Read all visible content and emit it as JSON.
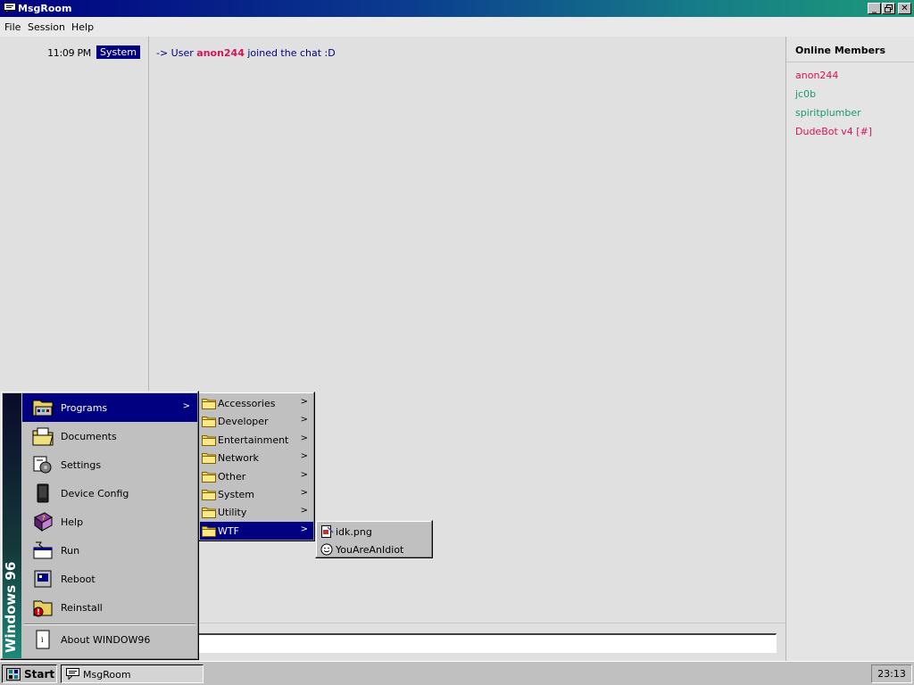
{
  "window": {
    "title": "MsgRoom",
    "controls": {
      "minimize": "_",
      "maximize": "❐",
      "close": "✕"
    }
  },
  "menubar": [
    "File",
    "Session",
    "Help"
  ],
  "chat": {
    "time": "11:09 PM",
    "sender": "System",
    "message_prefix": "-> User",
    "user": "anon244",
    "message_suffix": "joined the chat :D"
  },
  "members": {
    "title": "Online Members",
    "list": [
      {
        "name": "anon244",
        "color": "#d4145a"
      },
      {
        "name": "jc0b",
        "color": "#1b9a6a"
      },
      {
        "name": "spiritplumber",
        "color": "#1b9a6a"
      },
      {
        "name": "DudeBot v4 [#]",
        "color": "#d4145a"
      }
    ]
  },
  "message_input": {
    "value": ""
  },
  "start_menu": {
    "brand": "Windows 96",
    "items": [
      {
        "label": "Programs",
        "icon": "programs-icon",
        "arrow": ">"
      },
      {
        "label": "Documents",
        "icon": "documents-icon"
      },
      {
        "label": "Settings",
        "icon": "settings-icon"
      },
      {
        "label": "Device Config",
        "icon": "device-icon"
      },
      {
        "label": "Help",
        "icon": "help-book-icon"
      },
      {
        "label": "Run",
        "icon": "run-icon"
      },
      {
        "label": "Reboot",
        "icon": "reboot-icon"
      },
      {
        "label": "Reinstall",
        "icon": "reinstall-icon"
      },
      {
        "label": "About WINDOW96",
        "icon": "about-icon"
      }
    ]
  },
  "programs_menu": [
    {
      "label": "Accessories",
      "arrow": ">"
    },
    {
      "label": "Developer",
      "arrow": ">"
    },
    {
      "label": "Entertainment",
      "arrow": ">"
    },
    {
      "label": "Network",
      "arrow": ">"
    },
    {
      "label": "Other",
      "arrow": ">"
    },
    {
      "label": "System",
      "arrow": ">"
    },
    {
      "label": "Utility",
      "arrow": ">"
    },
    {
      "label": "WTF",
      "arrow": ">"
    }
  ],
  "wtf_menu": [
    {
      "label": "idk.png",
      "icon": "image-file-icon"
    },
    {
      "label": "YouAreAnIdiot",
      "icon": "smiley-icon"
    }
  ],
  "taskbar": {
    "start_label": "Start",
    "task_label": "MsgRoom",
    "clock": "23:13"
  }
}
